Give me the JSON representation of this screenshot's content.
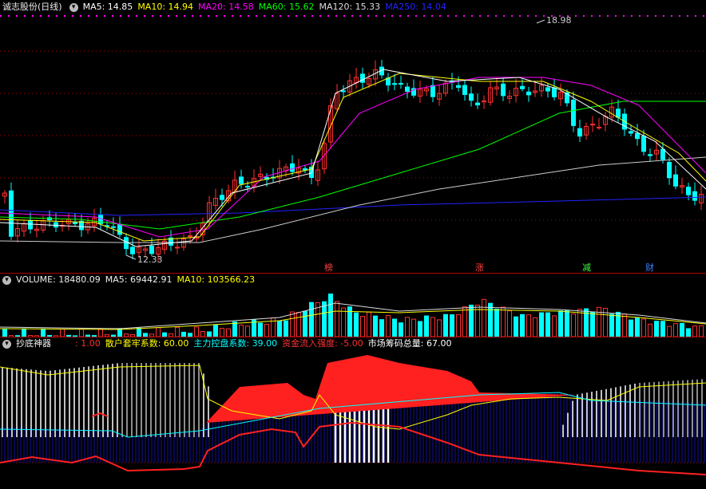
{
  "price_panel": {
    "stock_name": "诚志股份(日线)",
    "ma_items": [
      {
        "label": "MA5: 14.85",
        "color": "#ffffff"
      },
      {
        "label": "MA10: 14.94",
        "color": "#ffff00"
      },
      {
        "label": "MA20: 14.58",
        "color": "#ff00ff"
      },
      {
        "label": "MA60: 15.62",
        "color": "#00ff00"
      },
      {
        "label": "MA120: 15.33",
        "color": "#dddddd"
      },
      {
        "label": "MA250: 14.04",
        "color": "#2222ff"
      }
    ],
    "high_label": "18.98",
    "low_label": "12.33",
    "events": [
      {
        "label": "榜",
        "color": "#ff4040"
      },
      {
        "label": "涨",
        "color": "#ff4040"
      },
      {
        "label": "减",
        "color": "#40ff40"
      },
      {
        "label": "财",
        "color": "#4080ff"
      }
    ]
  },
  "volume_panel": {
    "title": "VOLUME: 18480.09",
    "ma5": "MA5: 69442.91",
    "ma10": "MA10: 103566.23"
  },
  "indicator_panel": {
    "title": "抄底神器",
    "params": [
      {
        "label": ": 1.00",
        "color": "#ff3030"
      },
      {
        "label": "散户套牢系数: 60.00",
        "color": "#ffff00"
      },
      {
        "label": "主力控盘系数: 39.00",
        "color": "#00ffff"
      },
      {
        "label": "资金流入强度: -5.00",
        "color": "#ff3030"
      },
      {
        "label": "市场筹码总量: 67.00",
        "color": "#ffffff"
      }
    ]
  },
  "colors": {
    "up": "#ff3030",
    "down": "#00ffff",
    "grid": "#b00000",
    "ma250": "#2222ff"
  },
  "icons": {
    "toggle": "circle-toggle-icon"
  }
}
